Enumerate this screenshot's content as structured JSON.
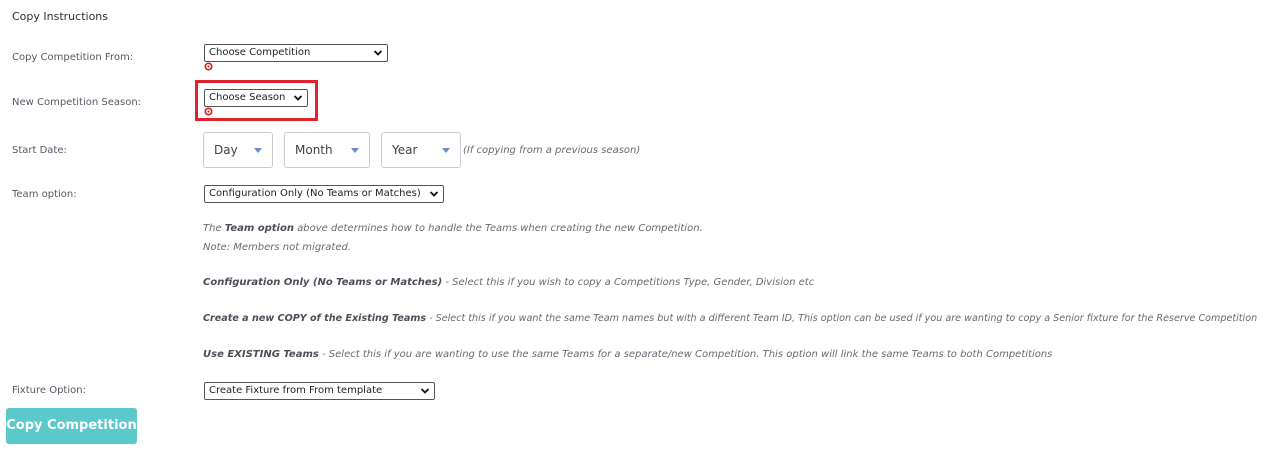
{
  "section_title": "Copy Instructions",
  "labels": {
    "copy_from": "Copy Competition From:",
    "new_season": "New Competition Season:",
    "start_date": "Start Date:",
    "team_option": "Team option:",
    "fixture_option": "Fixture Option:"
  },
  "selects": {
    "competition": "Choose Competition",
    "season": "Choose Season",
    "team_option": "Configuration Only (No Teams or Matches)",
    "fixture_option": "Create Fixture from From template"
  },
  "date": {
    "day": "Day",
    "month": "Month",
    "year": "Year",
    "hint": "(If copying from a previous season)"
  },
  "info": {
    "line1_pre": "The ",
    "line1_bold": "Team option",
    "line1_post": " above determines how to handle the Teams when creating the new Competition.",
    "line2": "Note: Members not migrated.",
    "opt1_bold": "Configuration Only (No Teams or Matches)",
    "opt1_text": " - Select this if you wish to copy a Competitions Type, Gender, Division etc",
    "opt2_bold": "Create a new COPY of the Existing Teams",
    "opt2_text": " - Select this if you want the same Team names but with a different Team ID, This option can be used if you are wanting to copy a Senior fixture for the Reserve Competition",
    "opt3_bold": "Use EXISTING Teams",
    "opt3_text": " - Select this if you are wanting to use the same Teams for a separate/new Competition. This option will link the same Teams to both Competitions"
  },
  "button": "Copy Competition",
  "colors": {
    "required_icon": "#cc2222",
    "highlight_border": "#e0222c",
    "button_bg": "#5bc8cc",
    "caret": "#6f8dbf"
  }
}
